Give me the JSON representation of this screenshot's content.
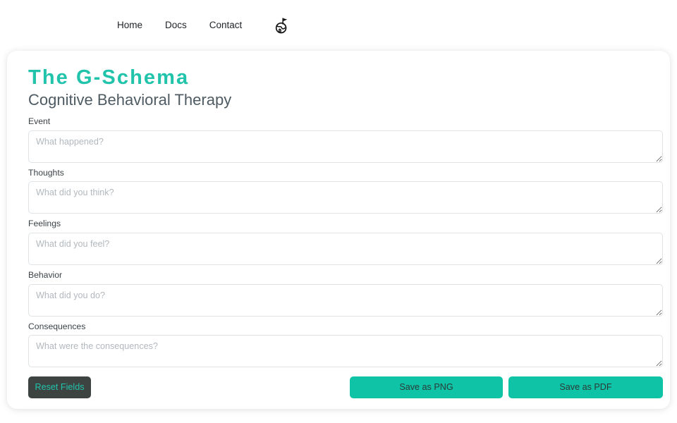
{
  "nav": {
    "links": [
      {
        "label": "Home"
      },
      {
        "label": "Docs"
      },
      {
        "label": "Contact"
      }
    ],
    "language_icon": "globe-flag-icon"
  },
  "header": {
    "title": "The G-Schema",
    "subtitle": "Cognitive Behavioral Therapy"
  },
  "form": {
    "fields": [
      {
        "label": "Event",
        "placeholder": "What happened?",
        "value": ""
      },
      {
        "label": "Thoughts",
        "placeholder": "What did you think?",
        "value": ""
      },
      {
        "label": "Feelings",
        "placeholder": "What did you feel?",
        "value": ""
      },
      {
        "label": "Behavior",
        "placeholder": "What did you do?",
        "value": ""
      },
      {
        "label": "Consequences",
        "placeholder": "What were the consequences?",
        "value": ""
      }
    ]
  },
  "actions": {
    "reset_label": "Reset Fields",
    "save_png_label": "Save as PNG",
    "save_pdf_label": "Save as PDF"
  },
  "colors": {
    "accent_teal": "#21c4ab",
    "button_teal": "#0fc3a6",
    "reset_dark": "#3d4341",
    "label_gray": "#3b4347",
    "placeholder_gray": "#b2b8bd"
  }
}
